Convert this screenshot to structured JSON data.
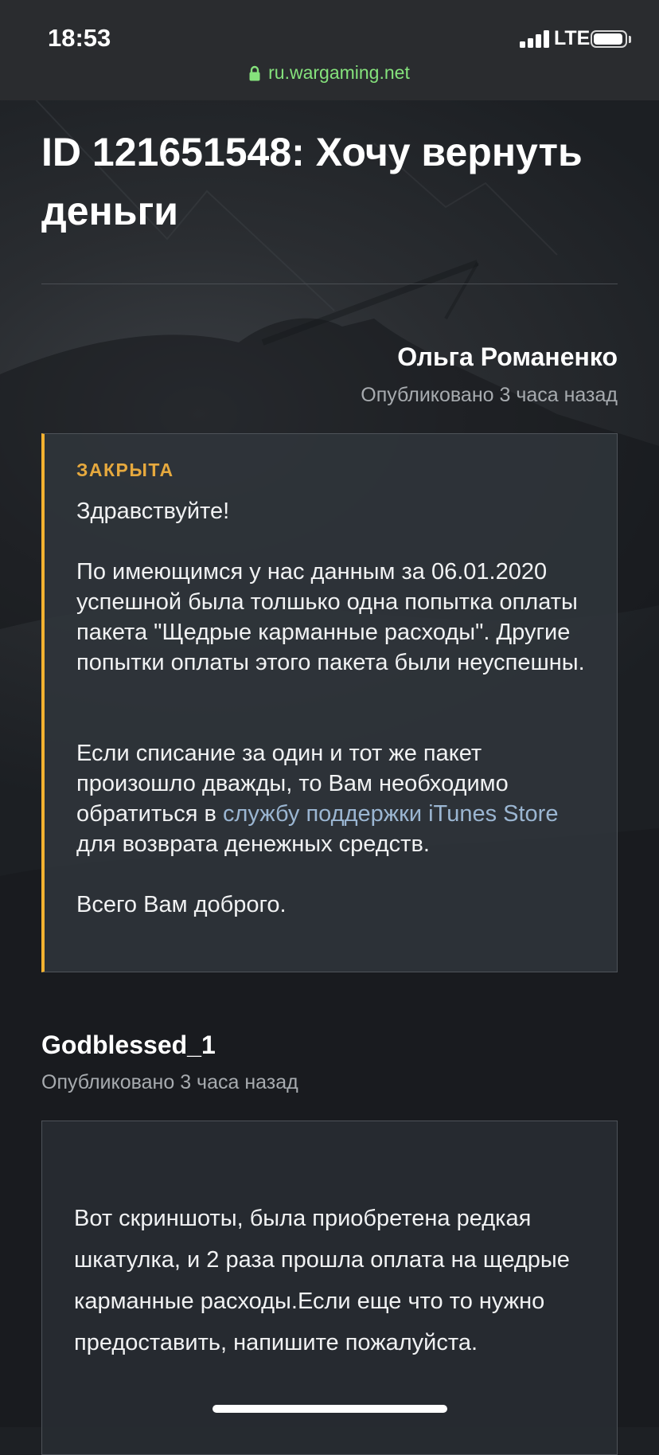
{
  "status_bar": {
    "time": "18:53",
    "network": "LTE",
    "url": "ru.wargaming.net",
    "signal_bars": 4,
    "battery_level": 0.95
  },
  "ticket": {
    "title": "ID 121651548: Хочу вернуть деньги"
  },
  "posts": [
    {
      "author": "Ольга Романенко",
      "published": "Опубликовано 3 часа назад",
      "status": "ЗАКРЫТА",
      "greeting": "Здравствуйте!",
      "paragraph_1": "По имеющимся у нас данным за 06.01.2020 успешной была толшько одна попытка оплаты пакета \"Щедрые карманные расходы\". Другие попытки оплаты этого пакета были неуспешны.",
      "paragraph_2_before": "Если списание за один и тот же пакет произошло дважды, то Вам необходимо обратиться в ",
      "paragraph_2_link": "службу поддержки iTunes Store",
      "paragraph_2_after": " для возврата денежных средств.",
      "closing": "Всего Вам доброго."
    },
    {
      "author": "Godblessed_1",
      "published": "Опубликовано 3 часа назад",
      "text": "Вот скриншоты, была приобретена редкая шкатулка, и 2 раза прошла оплата на щедрые карманные расходы.Если еще что то нужно предоставить, напишите пожалуйста."
    }
  ],
  "colors": {
    "accent": "#f3b230",
    "status_label": "#e6a93e",
    "link": "#9bb6d2",
    "url_text": "#85e27c",
    "background": "#1d2024"
  }
}
